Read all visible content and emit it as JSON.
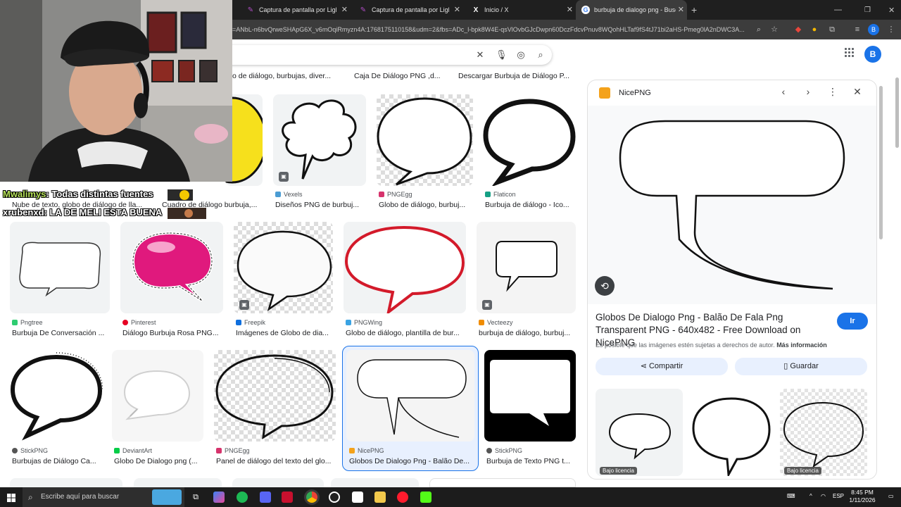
{
  "browser": {
    "tabs": [
      {
        "label": "Captura de pantalla por Lightsh",
        "icon": "lightshot-icon"
      },
      {
        "label": "Captura de pantalla por Lightsh",
        "icon": "lightshot-icon"
      },
      {
        "label": "Inicio / X",
        "icon": "x-logo-icon"
      },
      {
        "label": "burbuja de dialogo png - Busca",
        "icon": "google-icon"
      }
    ],
    "url": "=ANbL-n6bvQrweSHApG6X_v6mOqiRmyzn4A:1768175110158&udm=2&fbs=ADc_l-bpk8W4E-qsVlOvbGJcDwpn60DczFdcvPnuv8WQohHLTaf9fS4tJ71bi2aHS-Pmeg0lA2nDWC3A...",
    "profile_letter": "B"
  },
  "google": {
    "avatar_letter": "B"
  },
  "top_row_titles": [
    "o de diálogo, burbujas, diver...",
    "Caja De Diálogo PNG ,d...",
    "Descargar Burbuja de Diálogo P..."
  ],
  "results": [
    {
      "source": "",
      "title": ""
    },
    {
      "source": "Vexels",
      "title": "Diseños PNG de burbuj..."
    },
    {
      "source": "PNGEgg",
      "title": "Globo de diálogo, burbuj..."
    },
    {
      "source": "Flaticon",
      "title": "Burbuja de diálogo - Ico..."
    },
    {
      "source": "Pngtree",
      "title": "Burbuja De Conversación ..."
    },
    {
      "source": "Pinterest",
      "title": "Diálogo Burbuja Rosa PNG..."
    },
    {
      "source": "Freepik",
      "title": "Imágenes de Globo de dia..."
    },
    {
      "source": "PNGWing",
      "title": "Globo de diálogo, plantilla de bur..."
    },
    {
      "source": "Vecteezy",
      "title": "burbuja de diálogo, burbuj..."
    },
    {
      "source": "StickPNG",
      "title": "Burbujas de Diálogo Ca..."
    },
    {
      "source": "DeviantArt",
      "title": "Globo De Dialogo png (..."
    },
    {
      "source": "PNGEgg",
      "title": "Panel de diálogo del texto del glo..."
    },
    {
      "source": "NicePNG",
      "title": "Globos De Dialogo Png - Balão De..."
    },
    {
      "source": "StickPNG",
      "title": "Burbuja de Texto PNG t..."
    }
  ],
  "row2_left_titles": [
    "Nube de texto, globo de diálogo de lla...",
    "Cuadro de diálogo burbuja,..."
  ],
  "panel": {
    "site": "NicePNG",
    "title": "Globos De Dialogo Png - Balão De Fala Png Transparent PNG - 640x482 - Free Download on NicePNG",
    "go_label": "Ir",
    "note": "Es posible que las imágenes estén sujetas a derechos de autor.",
    "note_link": "Más información",
    "share_label": "Compartir",
    "save_label": "Guardar",
    "license_label": "Bajo licencia"
  },
  "chat": [
    {
      "user": "Mwalimys",
      "text": ": Todas distintas fuentes"
    },
    {
      "user": "xrubenxd",
      "text": ": LA DE MELI ESTA BUENA"
    }
  ],
  "taskbar": {
    "search_placeholder": "Escribe aquí para buscar",
    "lang": "ESP",
    "time": "8:45 PM",
    "date": "1/11/2026"
  },
  "colors": {
    "accent": "#1a73e8",
    "chrome_dark": "#1f1f1f",
    "selected_bg": "#e8f0fe"
  }
}
